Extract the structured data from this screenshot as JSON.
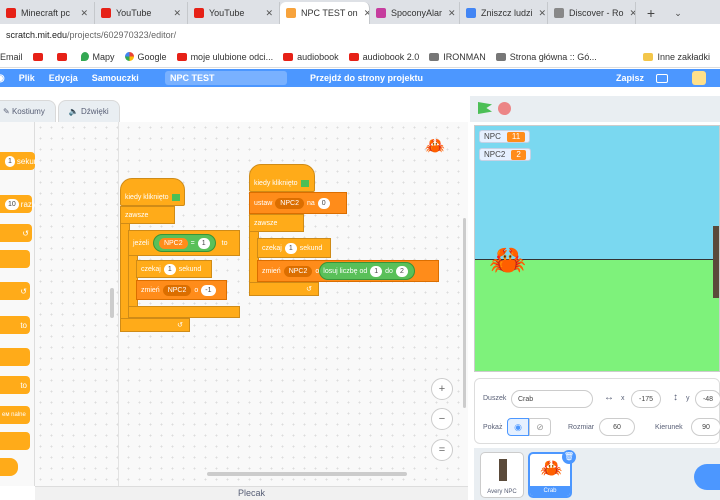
{
  "browser": {
    "tabs": [
      {
        "label": "Minecraft pc",
        "icon": "youtube-icon",
        "color": "#e62117"
      },
      {
        "label": "YouTube",
        "icon": "youtube-icon",
        "color": "#e62117"
      },
      {
        "label": "YouTube",
        "icon": "youtube-icon",
        "color": "#e62117"
      },
      {
        "label": "NPC TEST on",
        "icon": "scratch-icon",
        "color": "#f7a33c"
      },
      {
        "label": "SpoconyAlar",
        "icon": "app-icon",
        "color": "#c63d9e"
      },
      {
        "label": "Zniszcz ludzi",
        "icon": "app-icon",
        "color": "#4285f4"
      },
      {
        "label": "Discover - Ro",
        "icon": "app-icon",
        "color": "#888888"
      }
    ],
    "new_tab": "+",
    "address": {
      "host": "scratch.mit.edu",
      "path": "/projects/602970323/editor/"
    },
    "bookmarks": [
      "Email",
      "",
      "",
      "Mapy",
      "Google",
      "moje ulubione odci...",
      "audiobook",
      "audiobook 2.0",
      "IRONMAN",
      "Strona główna :: Gó...",
      "Inne zakładki"
    ]
  },
  "menubar": {
    "file": "Plik",
    "edit": "Edycja",
    "tutorials": "Samouczki",
    "project_title": "NPC TEST",
    "see_project": "Przejdź do strony projektu",
    "save": "Zapisz"
  },
  "editor_tabs": {
    "costumes": "Kostiumy",
    "sounds": "Dźwięki"
  },
  "palette": [
    "sekund",
    "razy",
    "",
    "",
    "",
    "",
    "",
    "",
    "",
    "",
    ""
  ],
  "script1": {
    "hat": "kiedy kliknięto",
    "forever": "zawsze",
    "if": "jeżeli",
    "var": "NPC2",
    "op": "=",
    "op_val": "1",
    "then": "to",
    "wait": "czekaj",
    "wait_val": "1",
    "wait_unit": "sekund",
    "change": "zmień",
    "change_var": "NPC2",
    "change_o": "o",
    "change_val": "-1"
  },
  "script2": {
    "hat": "kiedy kliknięto",
    "set": "ustaw",
    "set_var": "NPC2",
    "set_na": "na",
    "set_val": "0",
    "forever": "zawsze",
    "wait": "czekaj",
    "wait_val": "1",
    "wait_unit": "sekund",
    "change": "zmień",
    "change_var": "NPC2",
    "change_o": "o",
    "rand": "losuj liczbę od",
    "rand_from": "1",
    "rand_do": "do",
    "rand_to": "2"
  },
  "zoom": {
    "in": "+",
    "out": "−",
    "reset": "="
  },
  "backpack": "Plecak",
  "stage": {
    "monitors": [
      {
        "name": "NPC",
        "value": "11"
      },
      {
        "name": "NPC2",
        "value": "2"
      }
    ]
  },
  "sprite_info": {
    "sprite_label": "Duszek",
    "sprite_name": "Crab",
    "x_label": "x",
    "x_val": "-175",
    "y_label": "y",
    "y_val": "-48",
    "show_label": "Pokaż",
    "size_label": "Rozmiar",
    "size_val": "60",
    "dir_label": "Kierunek",
    "dir_val": "90"
  },
  "sprites": [
    {
      "name": "Avery NPC"
    },
    {
      "name": "Crab"
    }
  ],
  "colors": {
    "scratch_blue": "#4c97ff",
    "control": "#ffab19",
    "variables": "#ff8c1a",
    "operators": "#59c059"
  }
}
